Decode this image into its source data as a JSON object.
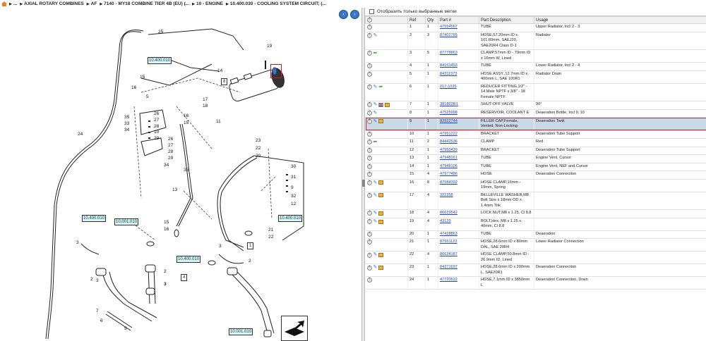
{
  "breadcrumb": {
    "items": [
      "...",
      "AXIAL ROTARY COMBINES",
      "AF",
      "7140 - MY18 COMBINE TIER 4B (EU) (...",
      "10 - ENGINE",
      "10.400.030 - COOLING SYSTEM CIRCUIT; (..."
    ]
  },
  "nav": {
    "back": "‹",
    "forward": "›"
  },
  "diagram": {
    "tags": [
      "10.400.010",
      "10.400.010",
      "10.001.010",
      "10.400.010",
      "10.400.010",
      "10.001.010"
    ],
    "boxes": [
      "8",
      "1",
      "4"
    ],
    "labels": [
      "25",
      "19",
      "14",
      "15",
      "16",
      "5",
      "17",
      "18",
      "11",
      "35",
      "33",
      "34",
      "26",
      "27",
      "28",
      "10",
      "29",
      "24",
      "16",
      "15",
      "26",
      "27",
      "28",
      "29",
      "34",
      "35",
      "23",
      "22",
      "20",
      "30",
      "31",
      "13",
      "9",
      "32",
      "12",
      "15",
      "16",
      "3",
      "21",
      "22",
      "3",
      "2",
      "3",
      "2",
      "3",
      "7",
      "6",
      "5",
      "2",
      "3"
    ]
  },
  "panel": {
    "filter_label": "Отобразить только выбранные метки",
    "columns": [
      "",
      "Ref",
      "Qty",
      "Part #",
      "Part Description",
      "Usage"
    ]
  },
  "rows": [
    {
      "ref": "1",
      "qty": "1",
      "part": "47554567",
      "desc": "TUBE",
      "usage": "Upper Radiator, Incl 2 - 3",
      "icons": [
        "add"
      ]
    },
    {
      "ref": "2",
      "qty": "3",
      "part": "87402765",
      "desc": "HOSE,57.20mm ID x 101.60mm, SAEJ20, SAE20R4 Class D-1",
      "usage": "Radiator",
      "icons": [
        "add",
        "wrench"
      ]
    },
    {
      "ref": "3",
      "qty": "5",
      "part": "87778863",
      "desc": "CLAMP,57mm ID - 79mm ID x 16mm W, Lined",
      "usage": "",
      "icons": [
        "add",
        "share"
      ]
    },
    {
      "ref": "4",
      "qty": "1",
      "part": "84151493",
      "desc": "TUBE",
      "usage": "Lower Radiator, Incl 2 - 4",
      "icons": [
        "add"
      ]
    },
    {
      "ref": "5",
      "qty": "1",
      "part": "84311373",
      "desc": "HOSE ASSY.,12.7mm ID x 400mm L, SAE 100R1",
      "usage": "Radiator Drain",
      "icons": [
        "add"
      ]
    },
    {
      "ref": "6",
      "qty": "1",
      "part": "217-1035",
      "desc": "REDUCER FITTING,1/2\" - 14 Male NPTF x 3/8\" - 18 Female NPTF",
      "usage": "",
      "icons": [
        "add",
        "wrench",
        "share"
      ]
    },
    {
      "ref": "7",
      "qty": "1",
      "part": "381803R1",
      "desc": "SHUT-OFF VALVE",
      "usage": "90°",
      "icons": [
        "add",
        "wrench",
        "flag",
        "box"
      ]
    },
    {
      "ref": "8",
      "qty": "1",
      "part": "47525998",
      "desc": "RESERVOIR, COOLANT E",
      "usage": "Deaeration Bottle, Incl 9, 10",
      "icons": [
        "add",
        "wrench"
      ]
    },
    {
      "ref": "9",
      "qty": "1",
      "part": "82822744",
      "desc": "FILLER CAP,Female, Vented, Non-Locking",
      "usage": "Deaeration Tank",
      "icons": [
        "add",
        "wrench",
        "box"
      ],
      "selected": true
    },
    {
      "ref": "10",
      "qty": "1",
      "part": "47951222",
      "desc": "BRACKET",
      "usage": "Deaeration Tube Support",
      "icons": [
        "add"
      ]
    },
    {
      "ref": "11",
      "qty": "2",
      "part": "84442536",
      "desc": "CLAMP",
      "usage": "Red",
      "icons": [
        "add",
        "share"
      ]
    },
    {
      "ref": "12",
      "qty": "1",
      "part": "47950439",
      "desc": "BRACKET",
      "usage": "Deaeration Tube Support",
      "icons": [
        "add"
      ]
    },
    {
      "ref": "13",
      "qty": "1",
      "part": "47948161",
      "desc": "TUBE",
      "usage": "Engine Vent, Cursor",
      "icons": [
        "add"
      ]
    },
    {
      "ref": "14",
      "qty": "1",
      "part": "47948106",
      "desc": "TUBE",
      "usage": "Engine Vent, NEF and Cursor",
      "icons": [
        "add"
      ]
    },
    {
      "ref": "15",
      "qty": "4",
      "part": "47977486",
      "desc": "HOSE",
      "usage": "Deaeration Connection",
      "icons": [
        "add"
      ]
    },
    {
      "ref": "16",
      "qty": "8",
      "part": "87584392",
      "desc": "HOSE CLAMP,16mm - 19mm, Spring",
      "usage": "",
      "icons": [
        "add",
        "wrench",
        "box"
      ]
    },
    {
      "ref": "17",
      "qty": "4",
      "part": "322358",
      "desc": "BELLEVILLE WASHER,M8 Bolt Size x 18mm OD x 1.4mm Thk",
      "usage": "",
      "icons": [
        "add",
        "wrench",
        "box"
      ]
    },
    {
      "ref": "18",
      "qty": "4",
      "part": "86629542",
      "desc": "LOCK NUT,M8 x 1.25, Cl 8.8",
      "usage": "",
      "icons": [
        "add",
        "wrench",
        "box"
      ]
    },
    {
      "ref": "19",
      "qty": "4",
      "part": "43129",
      "desc": "BOLT,Hex, M8 x 1.25 x 40mm, Cl 8.8",
      "usage": "",
      "icons": [
        "add",
        "wrench",
        "box"
      ]
    },
    {
      "ref": "20",
      "qty": "1",
      "part": "47428863",
      "desc": "TUBE",
      "usage": "Deaeration",
      "icons": [
        "add"
      ]
    },
    {
      "ref": "21",
      "qty": "1",
      "part": "87551123",
      "desc": "HOSE,28.6mm ID x 80mm DAL, SAE 20R4",
      "usage": "Lower Radiator Connection",
      "icons": [
        "add"
      ]
    },
    {
      "ref": "22",
      "qty": "4",
      "part": "86634187",
      "desc": "HOSE CLAMP,50.8mm ID - 26.9mm ID, Lined",
      "usage": "",
      "icons": [
        "add",
        "wrench",
        "box"
      ]
    },
    {
      "ref": "23",
      "qty": "1",
      "part": "84271697",
      "desc": "HOSE,28.6mm ID x 200mm L, SAE20R1",
      "usage": "Deaeration Connection",
      "icons": [
        "add",
        "wrench",
        "box"
      ]
    },
    {
      "ref": "24",
      "qty": "1",
      "part": "47720522",
      "desc": "HOSE,7.1mm ID x 3850mm L",
      "usage": "Deaeration Connection, Drain",
      "icons": [
        "add"
      ]
    }
  ]
}
